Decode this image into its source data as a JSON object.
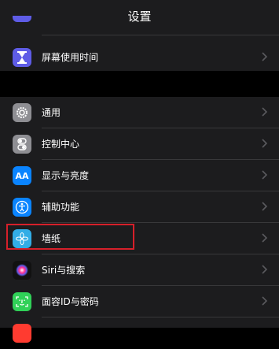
{
  "header": {
    "title": "设置"
  },
  "group1": {
    "items": [
      {
        "label": "",
        "icon": "purple-partial-icon",
        "color": "#5e5ce6"
      },
      {
        "label": "屏幕使用时间",
        "icon": "hourglass-icon",
        "color": "#5e5ce6"
      }
    ]
  },
  "group2": {
    "items": [
      {
        "label": "通用",
        "icon": "gear-icon",
        "color": "#8e8e93"
      },
      {
        "label": "控制中心",
        "icon": "toggles-icon",
        "color": "#8e8e93"
      },
      {
        "label": "显示与亮度",
        "icon": "aa-icon",
        "icon_text": "AA",
        "color": "#0a84ff"
      },
      {
        "label": "辅助功能",
        "icon": "accessibility-icon",
        "color": "#0a84ff"
      },
      {
        "label": "墙纸",
        "icon": "wallpaper-flower-icon",
        "color": "#32ade6"
      },
      {
        "label": "Siri与搜索",
        "icon": "siri-icon",
        "color": "#111111"
      },
      {
        "label": "面容ID与密码",
        "icon": "faceid-icon",
        "color": "#30d158"
      },
      {
        "label": "",
        "icon": "sos-partial-icon",
        "color": "#ff3b30"
      }
    ]
  },
  "highlight": {
    "target": "墙纸",
    "color": "#d6202a"
  }
}
